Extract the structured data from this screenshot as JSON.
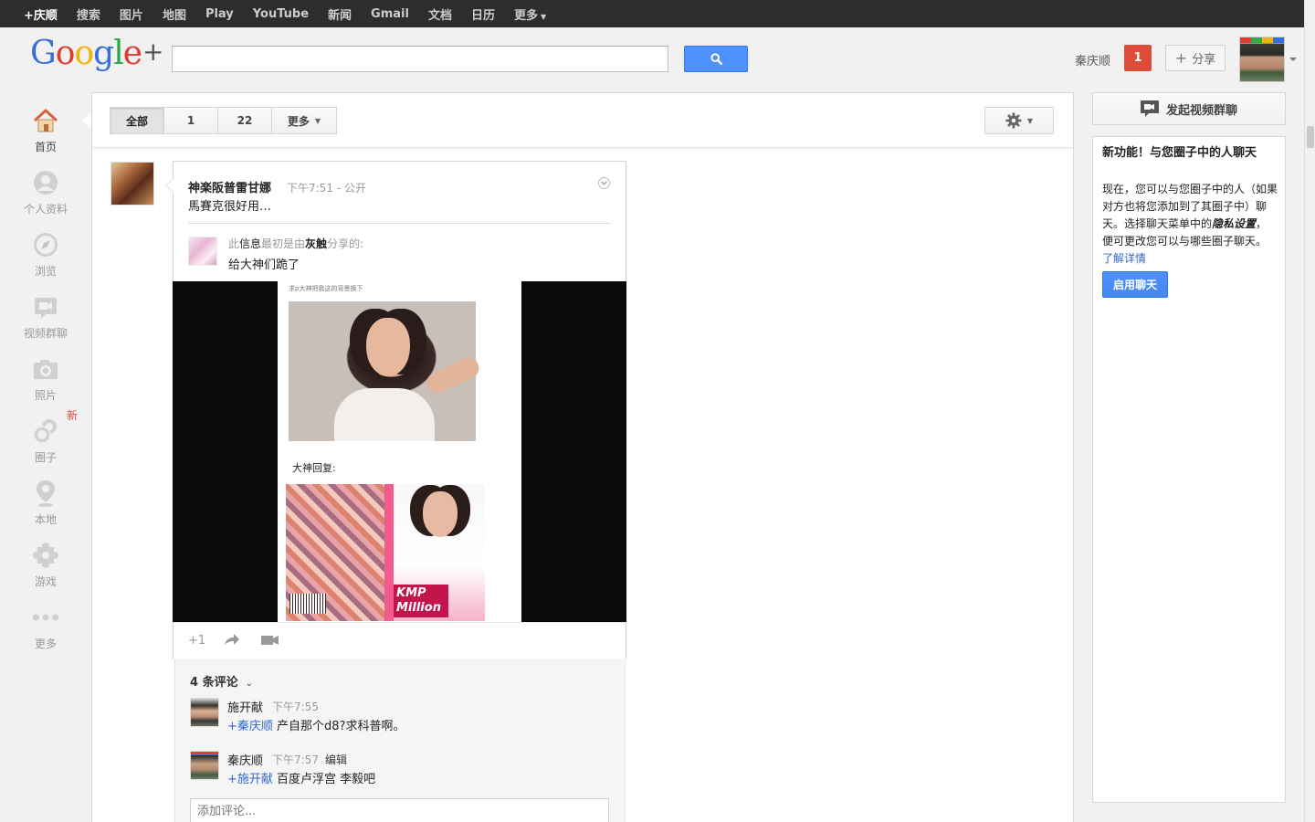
{
  "topbar": {
    "items": [
      "+庆顺",
      "搜索",
      "图片",
      "地图",
      "Play",
      "YouTube",
      "新闻",
      "Gmail",
      "文档",
      "日历",
      "更多"
    ]
  },
  "header": {
    "logo_text": "Google",
    "logo_plus": "+",
    "search_placeholder": "",
    "user_name": "秦庆顺",
    "notification_count": "1",
    "share_label": "分享"
  },
  "leftnav": {
    "items": [
      {
        "label": "首页",
        "icon": "home-icon"
      },
      {
        "label": "个人资料",
        "icon": "profile-icon"
      },
      {
        "label": "浏览",
        "icon": "explore-icon"
      },
      {
        "label": "视频群聊",
        "icon": "hangout-icon"
      },
      {
        "label": "照片",
        "icon": "camera-icon"
      },
      {
        "label": "圈子",
        "icon": "circles-icon"
      },
      {
        "label": "本地",
        "icon": "location-pin-icon"
      },
      {
        "label": "游戏",
        "icon": "puzzle-icon"
      },
      {
        "label": "更多",
        "icon": "more-dots-icon"
      }
    ],
    "new_badge": "新"
  },
  "filters": {
    "items": [
      "全部",
      "1",
      "22",
      "更多"
    ]
  },
  "post": {
    "author": "神楽阪普雷甘娜",
    "time": "下午7:51",
    "separator": "-",
    "visibility": "公开",
    "text": "馬賽克很好用…",
    "orig_prefix": "此",
    "orig_word": "信息",
    "orig_middle": "最初是由",
    "orig_author": "灰触",
    "orig_suffix": "分享的:",
    "orig_text": "给大神们跪了",
    "image_caption": "求p大神把我这的背景换下",
    "image_reply_label": "大神回复:",
    "kmp_text": "KMP Million",
    "plus_one": "+1"
  },
  "comments": {
    "count_label": "4 条评论",
    "items": [
      {
        "name": "施开献",
        "time": "下午7:55",
        "edit": "",
        "mention": "+秦庆顺",
        "text": " 产自那个d8?求科普啊。"
      },
      {
        "name": "秦庆顺",
        "time": "下午7:57",
        "edit": "编辑",
        "mention": "+施开献",
        "text": " 百度卢浮宫 李毅吧"
      }
    ],
    "add_placeholder": "添加评论..."
  },
  "right": {
    "hangout_label": "发起视频群聊",
    "chat_title": "新功能！与您圈子中的人聊天",
    "chat_body_1": "现在，您可以与您圈子中的人（如果对方也将您添加到了其圈子中）聊天。选择聊天菜单中的",
    "chat_body_em": "隐私设置",
    "chat_body_2": "，便可更改您可以与哪些圈子聊天。",
    "chat_link": "了解详情",
    "enable_label": "启用聊天"
  },
  "colors": {
    "accent_blue": "#4d90fe",
    "notification_red": "#dd4b39",
    "link_blue": "#3366cc"
  }
}
